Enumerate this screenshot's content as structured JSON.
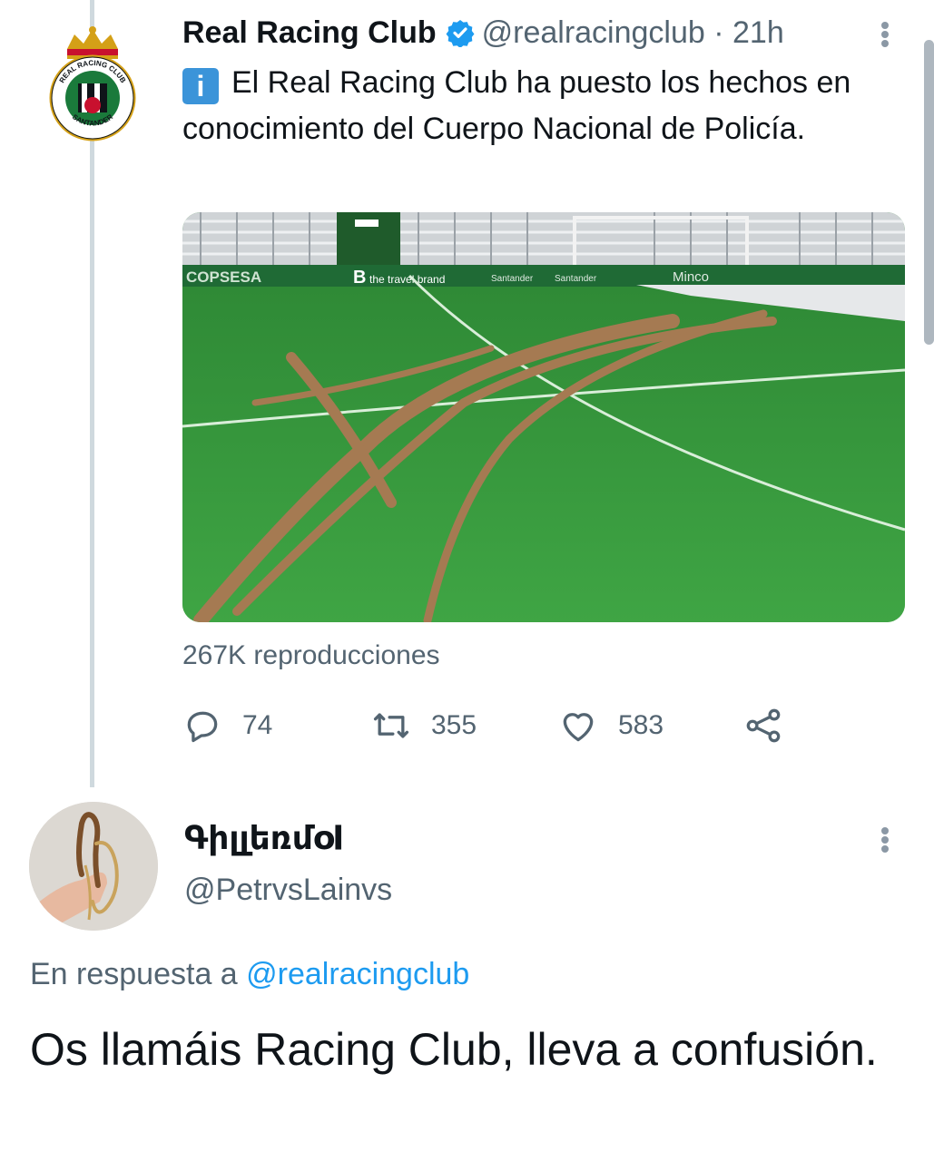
{
  "tweet": {
    "author_name": "Real Racing Club",
    "handle": "@realracingclub",
    "separator": " · ",
    "time": "21h",
    "info_badge": "i",
    "text": "El Real Racing Club ha puesto los hechos en conocimiento del Cuerpo Nacional de Policía.",
    "media_ads": {
      "ad1": "COPSESA",
      "ad2": "B",
      "ad3": "the travel brand",
      "ad4": "Santander",
      "ad5": "Santander",
      "ad6": "Minco"
    },
    "views": "267K reproducciones",
    "stats": {
      "replies": "74",
      "retweets": "355",
      "likes": "583"
    },
    "logo_text": {
      "top": "REAL RACING CLUB",
      "bottom": "SANTANDER"
    }
  },
  "reply": {
    "author_name": "Գիլլեռմօ𝐈",
    "handle": "@PetrvsLainvs",
    "reply_to_label": "En respuesta a ",
    "reply_to_handle": "@realracingclub",
    "text": "Os llamáis Racing Club, lleva a confusión."
  },
  "colors": {
    "accent": "#1d9bf0",
    "muted": "#536471",
    "text": "#0f1419",
    "thread_line": "#cfd9de",
    "info_badge": "#3b94d9"
  },
  "icons": [
    "verified-badge-icon",
    "more-options-icon",
    "reply-icon",
    "retweet-icon",
    "like-icon",
    "share-icon"
  ]
}
